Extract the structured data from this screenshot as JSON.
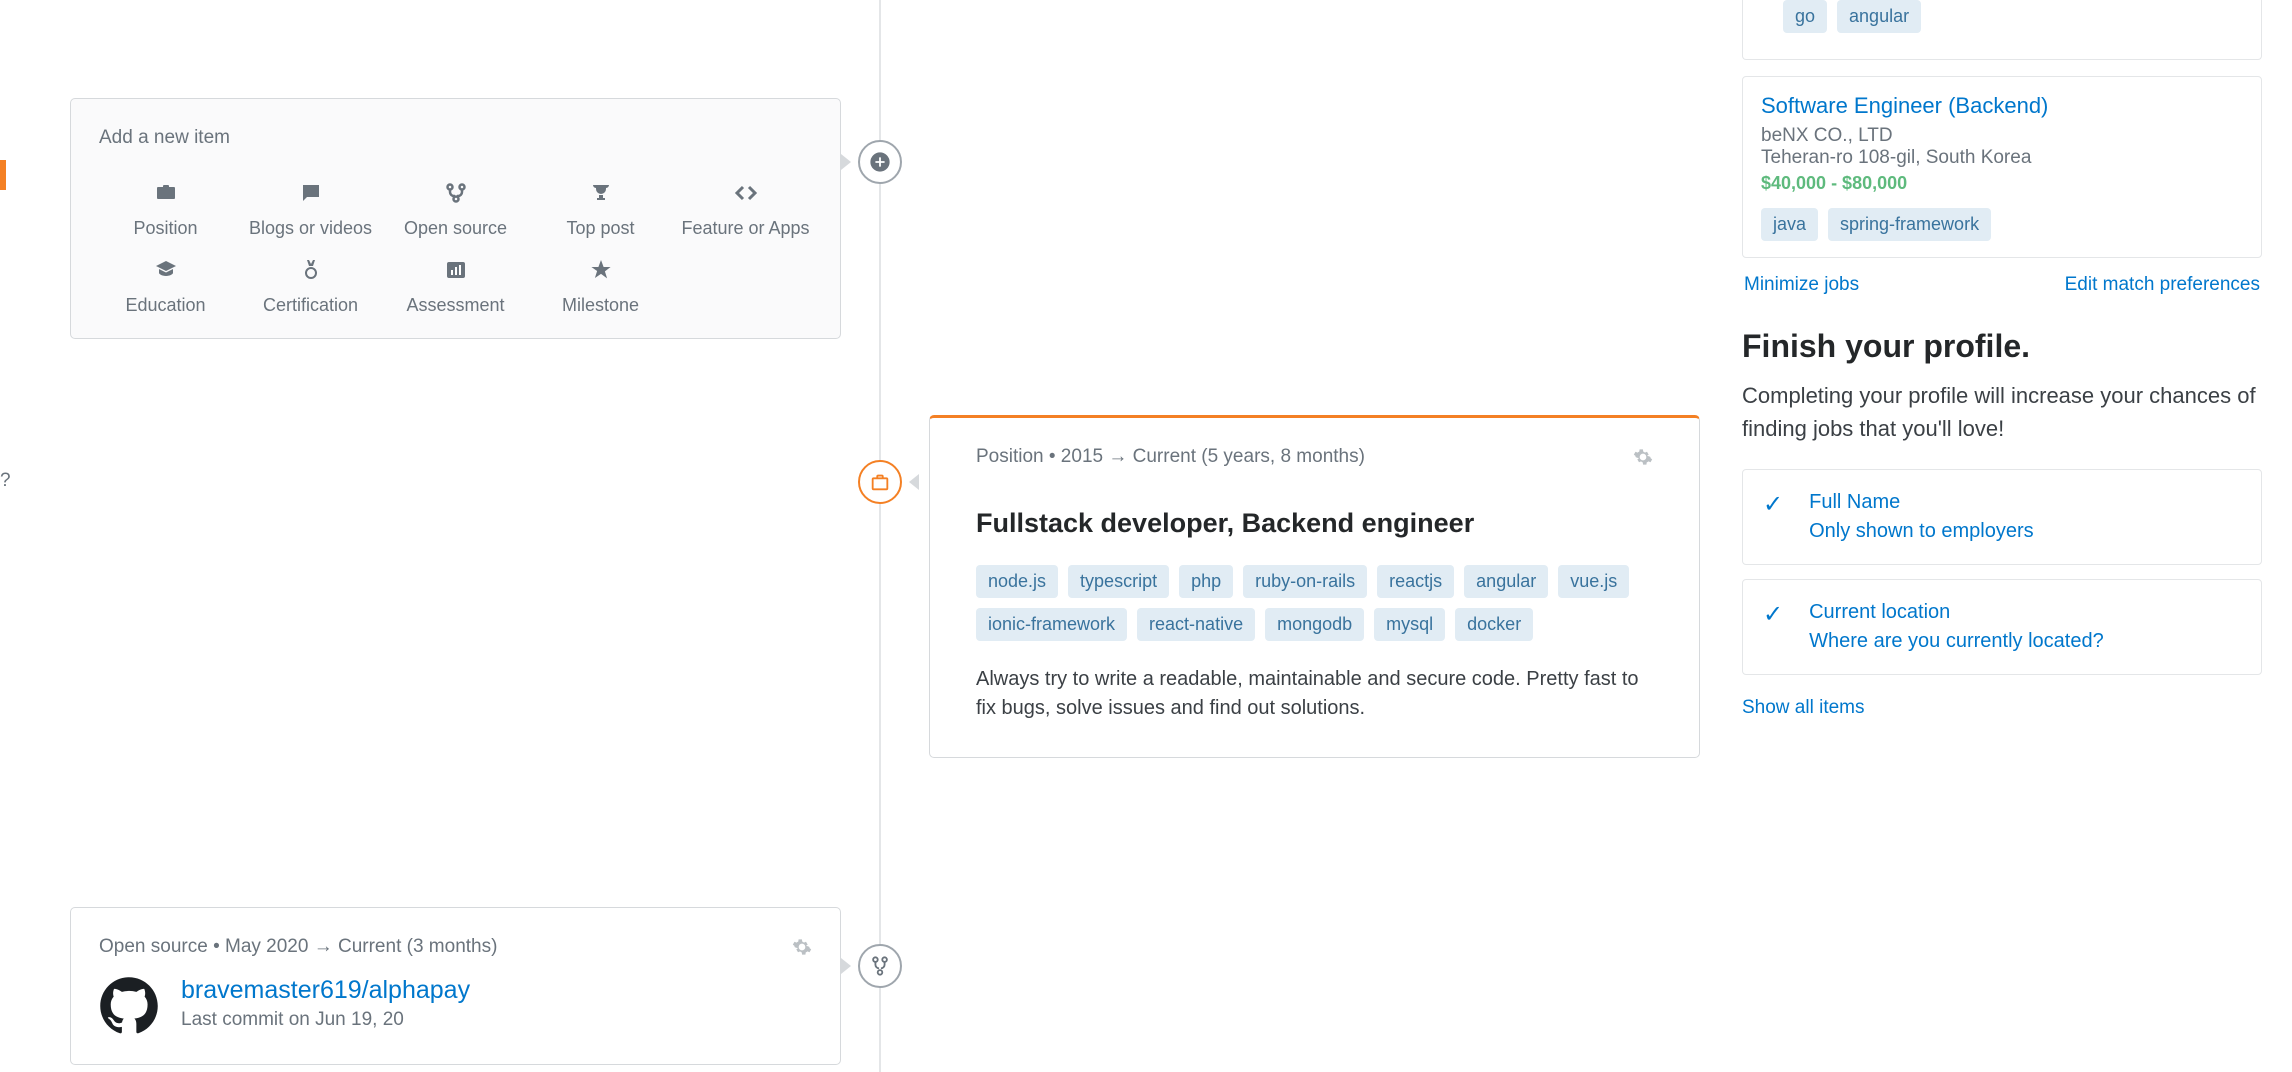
{
  "addItem": {
    "title": "Add a new item",
    "items": [
      {
        "label": "Position"
      },
      {
        "label": "Blogs or videos"
      },
      {
        "label": "Open source"
      },
      {
        "label": "Top post"
      },
      {
        "label": "Feature or Apps"
      },
      {
        "label": "Education"
      },
      {
        "label": "Certification"
      },
      {
        "label": "Assessment"
      },
      {
        "label": "Milestone"
      }
    ]
  },
  "position": {
    "meta": "Position • 2015 → Current (5 years, 8 months)",
    "title": "Fullstack developer, Backend engineer",
    "tags": [
      "node.js",
      "typescript",
      "php",
      "ruby-on-rails",
      "reactjs",
      "angular",
      "vue.js",
      "ionic-framework",
      "react-native",
      "mongodb",
      "mysql",
      "docker"
    ],
    "description": "Always try to write a readable, maintainable and secure code. Pretty fast to fix bugs, solve issues and find out solutions."
  },
  "openSource": {
    "meta": "Open source • May 2020 → Current (3 months)",
    "repo": "bravemaster619/alphapay",
    "lastCommit": "Last commit on Jun 19, 20"
  },
  "sidebar": {
    "partialJobTags": [
      "go",
      "angular"
    ],
    "job": {
      "title": "Software Engineer (Backend)",
      "company": "beNX CO., LTD",
      "location": "Teheran-ro 108-gil, South Korea",
      "salary": "$40,000 - $80,000",
      "tags": [
        "java",
        "spring-framework"
      ]
    },
    "links": {
      "minimize": "Minimize jobs",
      "edit": "Edit match preferences"
    },
    "finish": {
      "heading": "Finish your profile.",
      "text": "Completing your profile will increase your chances of finding jobs that you'll love!"
    },
    "profileItems": [
      {
        "title": "Full Name",
        "sub": "Only shown to employers"
      },
      {
        "title": "Current location",
        "sub": "Where are you currently located?"
      }
    ],
    "showAll": "Show all items"
  }
}
